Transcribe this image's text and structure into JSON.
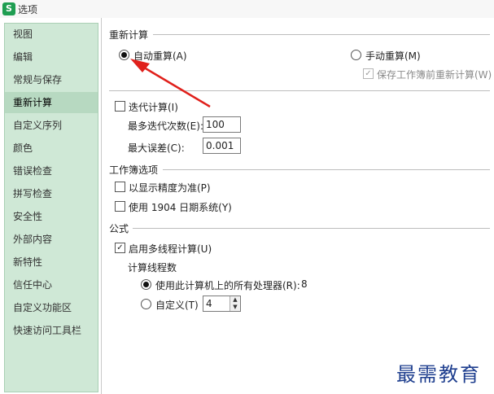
{
  "window": {
    "icon_text": "S",
    "title": "选项"
  },
  "sidebar": {
    "items": [
      {
        "label": "视图"
      },
      {
        "label": "编辑"
      },
      {
        "label": "常规与保存"
      },
      {
        "label": "重新计算",
        "active": true
      },
      {
        "label": "自定义序列"
      },
      {
        "label": "颜色"
      },
      {
        "label": "错误检查"
      },
      {
        "label": "拼写检查"
      },
      {
        "label": "安全性"
      },
      {
        "label": "外部内容"
      },
      {
        "label": "新特性"
      },
      {
        "label": "信任中心"
      },
      {
        "label": "自定义功能区"
      },
      {
        "label": "快速访问工具栏"
      }
    ]
  },
  "recalc": {
    "group_title": "重新计算",
    "auto_label": "自动重算(A)",
    "auto_checked": true,
    "manual_label": "手动重算(M)",
    "manual_checked": false,
    "save_before_label": "保存工作簿前重新计算(W)",
    "save_before_checked": true,
    "save_before_disabled": true
  },
  "iteration": {
    "label": "迭代计算(I)",
    "checked": false,
    "max_count_label": "最多迭代次数(E):",
    "max_count_value": "100",
    "max_error_label": "最大误差(C):",
    "max_error_value": "0.001"
  },
  "workbook": {
    "group_title": "工作簿选项",
    "precision_label": "以显示精度为准(P)",
    "precision_checked": false,
    "date1904_label": "使用 1904 日期系统(Y)",
    "date1904_checked": false
  },
  "formula": {
    "group_title": "公式",
    "multithread_label": "启用多线程计算(U)",
    "multithread_checked": true,
    "threads_title": "计算线程数",
    "all_processors_label": "使用此计算机上的所有处理器(R):",
    "all_processors_value": "8",
    "all_processors_checked": true,
    "custom_label": "自定义(T)",
    "custom_checked": false,
    "custom_value": "4"
  },
  "watermark": {
    "text": "最需教育"
  },
  "colors": {
    "sidebar_bg": "#cfe8d6",
    "active_item": "#b7d9c1",
    "arrow": "#e0201b",
    "watermark": "#1f3f8f"
  }
}
